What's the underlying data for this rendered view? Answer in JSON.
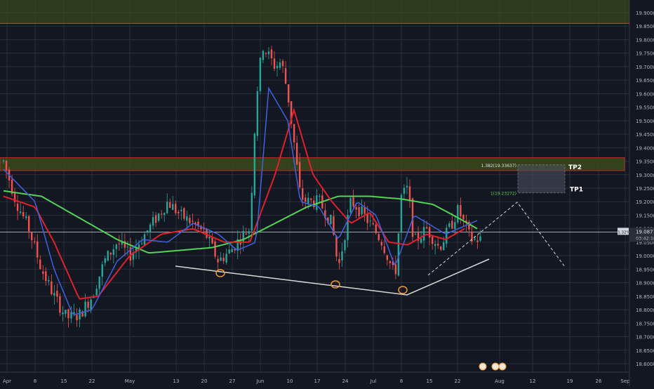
{
  "chart_data": {
    "type": "candlestick",
    "instrument_hint": "USD/MXN-like daily",
    "colors": {
      "background": "#131722",
      "grid": "#2a2e39",
      "bull": "#26a69a",
      "bear": "#ef5350",
      "ma_fast": "#3f62e0",
      "ma_mid": "#e0202a",
      "ma_slow": "#54d356",
      "resistance": "#d32f2f",
      "zone_fill": "#3a4a1c",
      "axis_text": "#b2b5be",
      "marker": "#f0962e"
    },
    "y_ticks": [
      "19.90000",
      "19.85000",
      "19.80000",
      "19.75000",
      "19.70000",
      "19.65000",
      "19.60000",
      "19.55000",
      "19.50000",
      "19.45000",
      "19.40000",
      "19.35000",
      "19.30000",
      "19.25000",
      "19.20000",
      "19.15000",
      "19.10000",
      "19.05000",
      "19.00000",
      "18.95000",
      "18.90000",
      "18.85000",
      "18.80000",
      "18.75000",
      "18.70000",
      "18.65000",
      "18.60000"
    ],
    "ylim": [
      18.6,
      19.9
    ],
    "x_ticks": [
      "Apr",
      "8",
      "15",
      "22",
      "May",
      "13",
      "20",
      "27",
      "Jun",
      "10",
      "17",
      "24",
      "Jul",
      "8",
      "15",
      "22",
      "Aug",
      "12",
      "19",
      "26",
      "Sep"
    ],
    "current_price": "19.08773",
    "change_label": "-1.32%",
    "countdown": "03:42:10",
    "tp_labels": {
      "tp2": "TP2",
      "tp1": "TP1",
      "tp2_level": "1.382(19.33637)",
      "tp1_level": "1(19.23272)"
    },
    "levels": {
      "top_resistance": 19.86,
      "zone_high": 19.363,
      "zone_low": 19.315,
      "tp2": 19.33637,
      "tp1": 19.23272,
      "current": 19.08773
    },
    "ma_fast_anchors": [
      [
        0,
        19.32
      ],
      [
        0.05,
        19.2
      ],
      [
        0.08,
        18.95
      ],
      [
        0.11,
        18.78
      ],
      [
        0.14,
        18.8
      ],
      [
        0.18,
        18.98
      ],
      [
        0.22,
        19.06
      ],
      [
        0.26,
        19.05
      ],
      [
        0.3,
        19.12
      ],
      [
        0.34,
        19.08
      ],
      [
        0.37,
        19.02
      ],
      [
        0.4,
        19.05
      ],
      [
        0.42,
        19.62
      ],
      [
        0.45,
        19.5
      ],
      [
        0.47,
        19.2
      ],
      [
        0.5,
        19.18
      ],
      [
        0.53,
        19.06
      ],
      [
        0.56,
        19.2
      ],
      [
        0.59,
        19.15
      ],
      [
        0.62,
        18.96
      ],
      [
        0.65,
        19.15
      ],
      [
        0.7,
        19.08
      ],
      [
        0.75,
        19.13
      ]
    ],
    "ma_mid_anchors": [
      [
        0,
        19.22
      ],
      [
        0.05,
        19.18
      ],
      [
        0.08,
        19.05
      ],
      [
        0.12,
        18.84
      ],
      [
        0.15,
        18.85
      ],
      [
        0.2,
        19.0
      ],
      [
        0.25,
        19.08
      ],
      [
        0.3,
        19.1
      ],
      [
        0.35,
        19.05
      ],
      [
        0.39,
        19.05
      ],
      [
        0.43,
        19.3
      ],
      [
        0.46,
        19.54
      ],
      [
        0.49,
        19.3
      ],
      [
        0.52,
        19.2
      ],
      [
        0.55,
        19.12
      ],
      [
        0.58,
        19.16
      ],
      [
        0.61,
        19.05
      ],
      [
        0.64,
        19.04
      ],
      [
        0.67,
        19.08
      ],
      [
        0.7,
        19.06
      ],
      [
        0.73,
        19.1
      ]
    ],
    "ma_slow_anchors": [
      [
        0,
        19.24
      ],
      [
        0.06,
        19.22
      ],
      [
        0.12,
        19.14
      ],
      [
        0.18,
        19.06
      ],
      [
        0.23,
        19.01
      ],
      [
        0.28,
        19.02
      ],
      [
        0.33,
        19.03
      ],
      [
        0.38,
        19.06
      ],
      [
        0.43,
        19.12
      ],
      [
        0.48,
        19.18
      ],
      [
        0.53,
        19.22
      ],
      [
        0.58,
        19.22
      ],
      [
        0.63,
        19.21
      ],
      [
        0.68,
        19.19
      ],
      [
        0.72,
        19.14
      ],
      [
        0.75,
        19.1
      ]
    ],
    "price_anchors": [
      [
        0,
        19.35
      ],
      [
        0.02,
        19.2
      ],
      [
        0.04,
        19.1
      ],
      [
        0.06,
        18.95
      ],
      [
        0.08,
        18.85
      ],
      [
        0.1,
        18.77
      ],
      [
        0.12,
        18.78
      ],
      [
        0.14,
        18.85
      ],
      [
        0.16,
        18.98
      ],
      [
        0.18,
        19.05
      ],
      [
        0.2,
        19.0
      ],
      [
        0.23,
        19.1
      ],
      [
        0.26,
        19.2
      ],
      [
        0.28,
        19.15
      ],
      [
        0.3,
        19.12
      ],
      [
        0.32,
        19.08
      ],
      [
        0.34,
        18.98
      ],
      [
        0.36,
        19.02
      ],
      [
        0.38,
        19.08
      ],
      [
        0.39,
        19.1
      ],
      [
        0.4,
        19.58
      ],
      [
        0.41,
        19.78
      ],
      [
        0.43,
        19.7
      ],
      [
        0.44,
        19.72
      ],
      [
        0.45,
        19.6
      ],
      [
        0.46,
        19.42
      ],
      [
        0.47,
        19.22
      ],
      [
        0.48,
        19.2
      ],
      [
        0.5,
        19.2
      ],
      [
        0.52,
        19.12
      ],
      [
        0.53,
        18.95
      ],
      [
        0.55,
        19.2
      ],
      [
        0.56,
        19.18
      ],
      [
        0.58,
        19.12
      ],
      [
        0.6,
        19.05
      ],
      [
        0.62,
        18.92
      ],
      [
        0.63,
        19.22
      ],
      [
        0.64,
        19.25
      ],
      [
        0.65,
        19.05
      ],
      [
        0.67,
        19.1
      ],
      [
        0.69,
        19.03
      ],
      [
        0.71,
        19.12
      ],
      [
        0.72,
        19.17
      ],
      [
        0.74,
        19.06
      ]
    ],
    "markers": [
      [
        0.345,
        18.985
      ],
      [
        0.51,
        18.92
      ],
      [
        0.615,
        18.91
      ],
      [
        0.75,
        18.62
      ]
    ],
    "axis_price_fmt": "19.08773"
  }
}
